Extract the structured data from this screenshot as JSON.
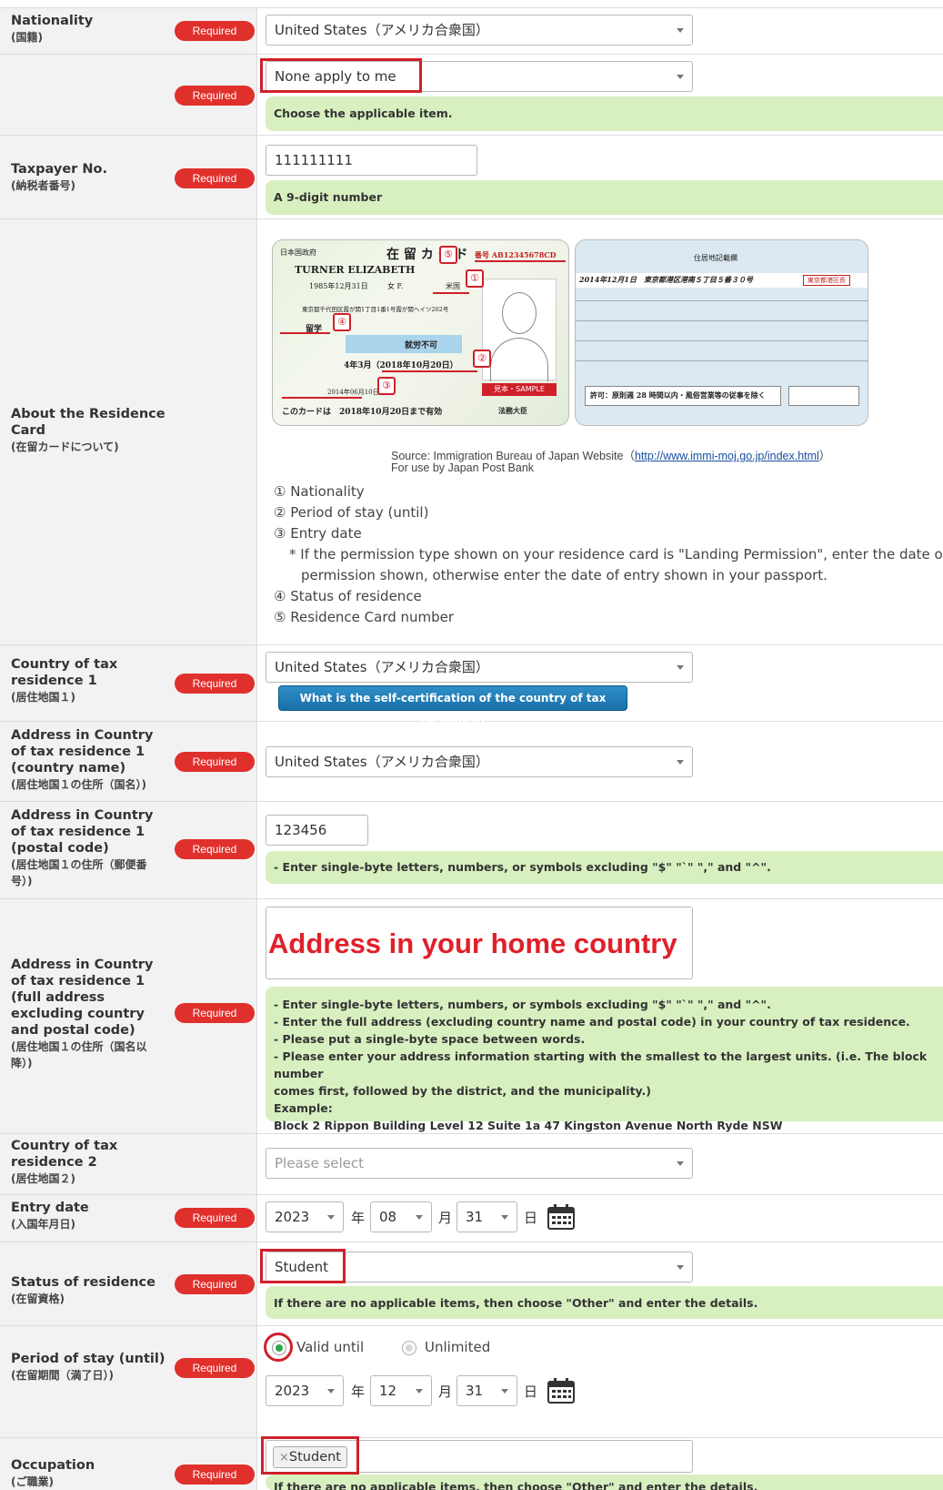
{
  "required_label": "Required",
  "nationality": {
    "label_en": "Nationality",
    "label_jp": "(国籍)",
    "value": "United States（アメリカ合衆国）"
  },
  "sanction": {
    "value": "None apply to me",
    "note": "Choose the applicable item."
  },
  "taxpayer": {
    "label_en": "Taxpayer No.",
    "label_jp": "(納税者番号)",
    "value": "111111111",
    "note": "A 9-digit number"
  },
  "residence_card": {
    "label_en": [
      "About the Residence",
      "Card"
    ],
    "label_jp": "(在留カードについて)",
    "source_line": "Source: Immigration Bureau of Japan Website（",
    "source_link": "http://www.immi-moj.go.jp/index.html",
    "source_close": "）",
    "use_line": "For use by Japan Post Bank",
    "items": [
      "① Nationality",
      "② Period of stay (until)",
      "③ Entry date"
    ],
    "entry_note_line1": "* If the permission type shown on your residence card is \"Landing Permission\", enter the date of",
    "entry_note_line2": "permission shown, otherwise enter the date of entry shown in your passport.",
    "items2": [
      "④ Status of residence",
      "⑤ Residence Card number"
    ],
    "card_front": {
      "header": "日本国政府",
      "title": "在 留 カ ー ド",
      "number": "番号 AB12345678CD",
      "name": "TURNER  ELIZABETH",
      "dob": "1985年12月31日",
      "sex": "女 F.",
      "nationality": "米国",
      "address": "東京都千代田区霞が関1丁目1番1号霞が関ヘイツ202号",
      "status": "留学",
      "work": "就労不可",
      "period": "4年3月（2018年10月20日）",
      "entry": "2014年06月10日",
      "validity": "このカードは　2018年10月20日まで有効",
      "issuer": "法務大臣",
      "sample": "見本・SAMPLE",
      "markers": [
        "⑤",
        "①",
        "④",
        "②",
        "③"
      ]
    },
    "card_back": {
      "title": "住居地記載欄",
      "date_row": "2014年12月1日　東京都港区港南５丁目５番３０号",
      "stamp": "東京都港区長",
      "permission": "許可：原則週 28 時間以内・風俗営業等の従事を除く"
    }
  },
  "tax_country_1": {
    "label_en": [
      "Country of tax",
      "residence 1"
    ],
    "label_jp": "(居住地国１)",
    "value": "United States（アメリカ合衆国）",
    "button": "What is the self-certification of the country of tax residence?"
  },
  "addr_country": {
    "label_en": [
      "Address in Country",
      "of tax residence 1",
      "(country name)"
    ],
    "label_jp": "(居住地国１の住所（国名）)",
    "value": "United States（アメリカ合衆国）"
  },
  "addr_postal": {
    "label_en": [
      "Address in Country",
      "of tax residence 1",
      "(postal code)"
    ],
    "label_jp": [
      "(居住地国１の住所（郵便番",
      "号）)"
    ],
    "value": "123456",
    "note": "- Enter single-byte letters, numbers, or symbols excluding \"$\" \"`\" \",\" and \"^\"."
  },
  "addr_full": {
    "label_en": [
      "Address in Country",
      "of tax residence 1",
      "(full address",
      "excluding country",
      "and postal code)"
    ],
    "label_jp": [
      "(居住地国１の住所（国名以",
      "降）)"
    ],
    "value": "Address in your home country",
    "notes": [
      "- Enter single-byte letters, numbers, or symbols excluding \"$\" \"`\" \",\" and \"^\".",
      "- Enter the full address (excluding country name and postal code) in your country of tax residence.",
      "- Please put a single-byte space between words.",
      "- Please enter your address information starting with the smallest to the largest units. (i.e. The block number",
      "comes first, followed by the district, and the municipality.)",
      "Example:",
      "Block 2 Rippon Building Level 12 Suite 1a 47 Kingston Avenue North Ryde NSW"
    ]
  },
  "tax_country_2": {
    "label_en": [
      "Country of tax",
      "residence 2"
    ],
    "label_jp": "(居住地国２)",
    "placeholder": "Please select"
  },
  "entry_date": {
    "label_en": "Entry date",
    "label_jp": "(入国年月日)",
    "year": "2023",
    "month": "08",
    "day": "31",
    "unit_year": "年",
    "unit_month": "月",
    "unit_day": "日"
  },
  "status": {
    "label_en": "Status of residence",
    "label_jp": "(在留資格)",
    "value": "Student",
    "note": "If there are no applicable items, then choose \"Other\" and enter the details."
  },
  "period": {
    "label_en": "Period of stay (until)",
    "label_jp": "(在留期間（満了日）)",
    "radio_valid": "Valid until",
    "radio_unlimited": "Unlimited",
    "year": "2023",
    "month": "12",
    "day": "31",
    "unit_year": "年",
    "unit_month": "月",
    "unit_day": "日"
  },
  "occupation": {
    "label_en": "Occupation",
    "label_jp": "(ご職業)",
    "tag": "Student",
    "tag_remove": "×",
    "note": "If there are no applicable items, then choose \"Other\" and enter the details."
  },
  "colors": {
    "required": "#e0302c",
    "note_bg": "#d8f0c0",
    "highlight": "#d0202a",
    "info_button": "#1f7ab5"
  }
}
